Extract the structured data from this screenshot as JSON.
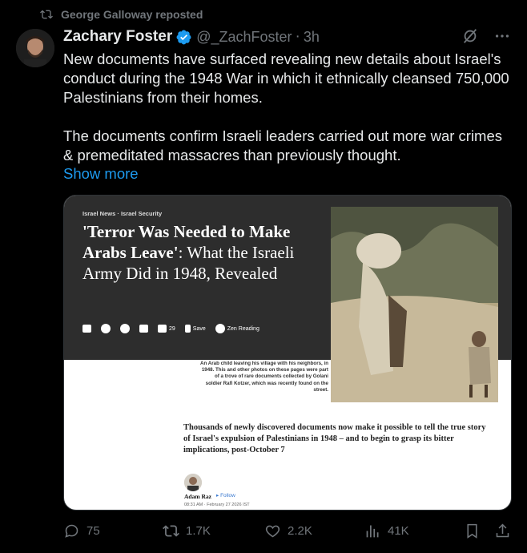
{
  "repost": {
    "text": "George Galloway reposted",
    "icon": "repost-icon"
  },
  "author": {
    "name": "Zachary Foster",
    "handle": "@_ZachFoster",
    "separator": "·",
    "time": "3h",
    "verified": true
  },
  "tweet": {
    "text": "New documents have surfaced revealing new details about Israel's conduct during the 1948 War in which it ethnically cleansed 750,000 Palestinians from their homes.\n\nThe documents confirm Israeli leaders carried out more war crimes & premeditated massacres than previously thought.",
    "show_more": "Show more"
  },
  "card": {
    "kicker": "Israel News · Israel Security",
    "headline_bold": "'Terror Was Needed to Make Arabs Leave'",
    "headline_colon": ":",
    "headline_rest": " What the Israeli Army Did in 1948, Revealed",
    "comment_count": "29",
    "save_label": "Save",
    "zen_label": "Zen Reading",
    "caption": "An Arab child leaving his village with his neighbors, in 1948. This and other photos on these pages were part of a trove of rare documents collected by Golani soldier Rafi Kotzer, which was recently found on the street.",
    "deck": "Thousands of newly discovered documents now make it possible to tell the true story of Israel's expulsion of Palestinians in 1948 – and to begin to grasp its bitter implications, post-October 7",
    "byline_author": "Adam Raz",
    "follow_label": "▸ Follow",
    "pub_date": "08:31 AM · February 27 2026 IST"
  },
  "actions": {
    "replies": "75",
    "reposts": "1.7K",
    "likes": "2.2K",
    "views": "41K"
  },
  "colors": {
    "background": "#000000",
    "text": "#e7e9ea",
    "muted": "#71767b",
    "link": "#1d9bf0"
  }
}
